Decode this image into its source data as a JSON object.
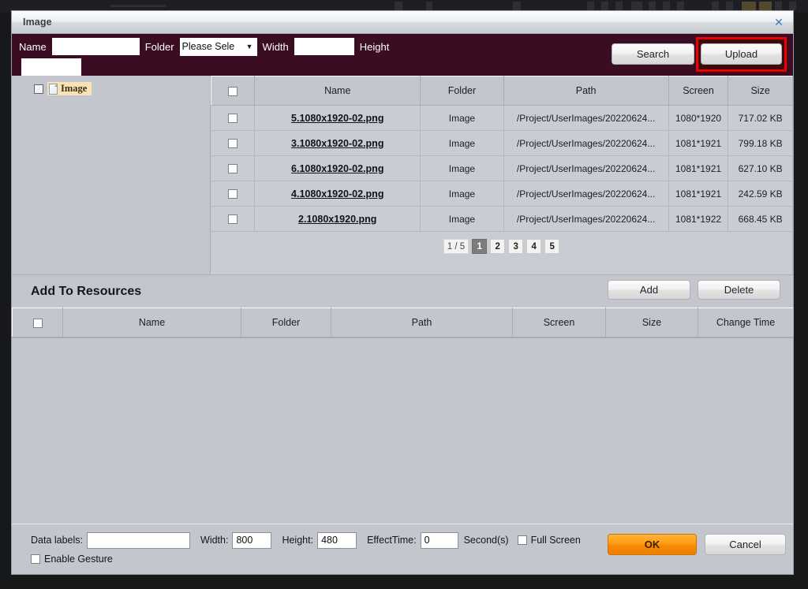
{
  "window": {
    "title": "Image",
    "close_icon": "close-icon"
  },
  "searchbar": {
    "name_label": "Name",
    "name_value": "",
    "folder_label": "Folder",
    "folder_selected": "Please Sele",
    "folder_chevron": "▼",
    "width_label": "Width",
    "width_value": "",
    "height_label": "Height",
    "height_value": "",
    "search_button": "Search",
    "upload_button": "Upload",
    "highlight_color": "#ee0000"
  },
  "tree": {
    "root_label": "Image",
    "root_icon": "file-icon",
    "checked": false
  },
  "file_table": {
    "columns": [
      "",
      "Name",
      "Folder",
      "Path",
      "Screen",
      "Size"
    ],
    "rows": [
      {
        "name": "5.1080x1920-02.png",
        "folder": "Image",
        "path": "/Project/UserImages/20220624...",
        "screen": "1080*1920",
        "size": "717.02 KB"
      },
      {
        "name": "3.1080x1920-02.png",
        "folder": "Image",
        "path": "/Project/UserImages/20220624...",
        "screen": "1081*1921",
        "size": "799.18 KB"
      },
      {
        "name": "6.1080x1920-02.png",
        "folder": "Image",
        "path": "/Project/UserImages/20220624...",
        "screen": "1081*1921",
        "size": "627.10 KB"
      },
      {
        "name": "4.1080x1920-02.png",
        "folder": "Image",
        "path": "/Project/UserImages/20220624...",
        "screen": "1081*1921",
        "size": "242.59 KB"
      },
      {
        "name": "2.1080x1920.png",
        "folder": "Image",
        "path": "/Project/UserImages/20220624...",
        "screen": "1081*1922",
        "size": "668.45 KB"
      }
    ],
    "pagination": {
      "info": "1 / 5",
      "pages": [
        "1",
        "2",
        "3",
        "4",
        "5"
      ],
      "active": "1"
    }
  },
  "resources": {
    "heading": "Add To Resources",
    "add_button": "Add",
    "delete_button": "Delete",
    "columns": [
      "",
      "Name",
      "Folder",
      "Path",
      "Screen",
      "Size",
      "Change Time"
    ],
    "rows": []
  },
  "bottombar": {
    "data_labels_label": "Data labels:",
    "data_labels_value": "",
    "width_label": "Width:",
    "width_value": "800",
    "height_label": "Height:",
    "height_value": "480",
    "effecttime_label": "EffectTime:",
    "effecttime_value": "0",
    "seconds_label": "Second(s)",
    "fullscreen_label": "Full Screen",
    "fullscreen_checked": false,
    "enable_gesture_label": "Enable Gesture",
    "enable_gesture_checked": false,
    "ok_button": "OK",
    "cancel_button": "Cancel",
    "ok_color": "#f89406"
  }
}
